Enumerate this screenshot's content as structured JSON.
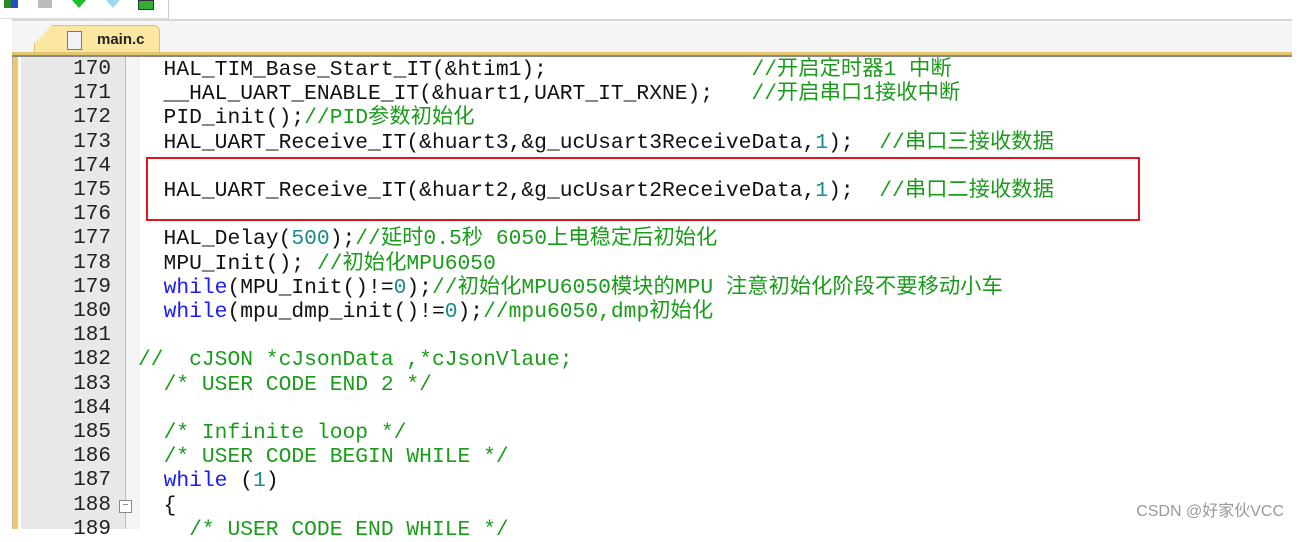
{
  "toolbar": {
    "icons": [
      "build-icon",
      "save-icon",
      "download-icon",
      "filter-icon",
      "debug-icon"
    ]
  },
  "tabs": [
    {
      "label": "main.c",
      "active": true
    }
  ],
  "editor": {
    "highlight_color": "#e0161e",
    "lines": [
      {
        "n": "170",
        "segs": [
          [
            "t",
            "  HAL_TIM_Base_Start_IT(&htim1);                "
          ],
          [
            "c",
            "//开启定时器1 中断"
          ]
        ]
      },
      {
        "n": "171",
        "segs": [
          [
            "t",
            "  __HAL_UART_ENABLE_IT(&huart1,UART_IT_RXNE);   "
          ],
          [
            "c",
            "//开启串口1接收中断"
          ]
        ]
      },
      {
        "n": "172",
        "segs": [
          [
            "t",
            "  PID_init();"
          ],
          [
            "c",
            "//PID参数初始化"
          ]
        ]
      },
      {
        "n": "173",
        "segs": [
          [
            "t",
            "  HAL_UART_Receive_IT(&huart3,&g_ucUsart3ReceiveData,"
          ],
          [
            "n",
            "1"
          ],
          [
            "t",
            ");  "
          ],
          [
            "c",
            "//串口三接收数据"
          ]
        ]
      },
      {
        "n": "174",
        "segs": []
      },
      {
        "n": "175",
        "segs": [
          [
            "t",
            "  HAL_UART_Receive_IT(&huart2,&g_ucUsart2ReceiveData,"
          ],
          [
            "n",
            "1"
          ],
          [
            "t",
            ");  "
          ],
          [
            "c",
            "//串口二接收数据"
          ]
        ]
      },
      {
        "n": "176",
        "segs": []
      },
      {
        "n": "177",
        "segs": [
          [
            "t",
            "  HAL_Delay("
          ],
          [
            "n",
            "500"
          ],
          [
            "t",
            ");"
          ],
          [
            "c",
            "//延时0.5秒 6050上电稳定后初始化"
          ]
        ]
      },
      {
        "n": "178",
        "segs": [
          [
            "t",
            "  MPU_Init(); "
          ],
          [
            "c",
            "//初始化MPU6050"
          ]
        ]
      },
      {
        "n": "179",
        "segs": [
          [
            "t",
            "  "
          ],
          [
            "k",
            "while"
          ],
          [
            "t",
            "(MPU_Init()!="
          ],
          [
            "n",
            "0"
          ],
          [
            "t",
            ");"
          ],
          [
            "c",
            "//初始化MPU6050模块的MPU 注意初始化阶段不要移动小车"
          ]
        ]
      },
      {
        "n": "180",
        "segs": [
          [
            "t",
            "  "
          ],
          [
            "k",
            "while"
          ],
          [
            "t",
            "(mpu_dmp_init()!="
          ],
          [
            "n",
            "0"
          ],
          [
            "t",
            ");"
          ],
          [
            "c",
            "//mpu6050,dmp初始化"
          ]
        ]
      },
      {
        "n": "181",
        "segs": []
      },
      {
        "n": "182",
        "segs": [
          [
            "c",
            "//  cJSON *cJsonData ,*cJsonVlaue;"
          ]
        ]
      },
      {
        "n": "183",
        "segs": [
          [
            "t",
            "  "
          ],
          [
            "c",
            "/* USER CODE END 2 */"
          ]
        ]
      },
      {
        "n": "184",
        "segs": []
      },
      {
        "n": "185",
        "segs": [
          [
            "t",
            "  "
          ],
          [
            "c",
            "/* Infinite loop */"
          ]
        ]
      },
      {
        "n": "186",
        "segs": [
          [
            "t",
            "  "
          ],
          [
            "c",
            "/* USER CODE BEGIN WHILE */"
          ]
        ]
      },
      {
        "n": "187",
        "segs": [
          [
            "t",
            "  "
          ],
          [
            "k",
            "while"
          ],
          [
            "t",
            " ("
          ],
          [
            "n",
            "1"
          ],
          [
            "t",
            ")"
          ]
        ]
      },
      {
        "n": "188",
        "segs": [
          [
            "t",
            "  {"
          ]
        ],
        "fold": "−"
      },
      {
        "n": "189",
        "segs": [
          [
            "t",
            "    "
          ],
          [
            "c",
            "/* USER CODE END WHILE */"
          ]
        ]
      }
    ]
  },
  "watermark": "CSDN @好家伙VCC"
}
